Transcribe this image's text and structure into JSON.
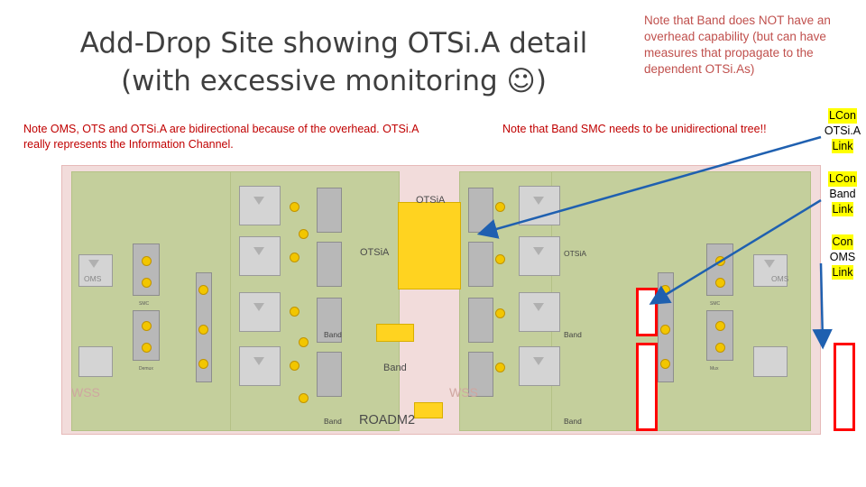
{
  "title": {
    "line1": "Add-Drop Site showing OTSi.A detail",
    "line2": "(with excessive monitoring ☺)",
    "text": "Add-Drop Site showing OTSi.A detail\n(with excessive monitoring ☺)"
  },
  "notes": {
    "orange_top_right": "Note that Band does NOT have an overhead capability (but can have measures that propagate to the dependent OTSi.As)",
    "red_left": "Note OMS, OTS and OTSi.A are bidirectional because of the overhead. OTSi.A really represents the Information Channel.",
    "red_middle": "Note that Band SMC needs to be unidirectional tree!!"
  },
  "legend": {
    "items": [
      {
        "name": "legend-otsia",
        "line1": "LCon",
        "line2": "OTSi.A",
        "line3": "Link"
      },
      {
        "name": "legend-band",
        "line1": "LCon",
        "line2": "Band",
        "line3": "Link"
      },
      {
        "name": "legend-oms",
        "line1": "Con",
        "line2": "OMS",
        "line3": "Link"
      }
    ]
  },
  "diagram": {
    "labels": {
      "otsia_big": "OTSiA",
      "otsia_small": "OTSiA",
      "band_right": "Band",
      "band_center": "Band",
      "band_bottom": "Band",
      "band_left": "Band",
      "oms_left": "OMS",
      "oms_right": "OMS",
      "wss_left": "WSS",
      "wss_right": "WSS",
      "roadm": "ROADM2"
    },
    "colors": {
      "frame_fill": "#f2dcdb",
      "node_fill": "#c4cf9c",
      "highlight": "#ffd320",
      "arrow": "#1f60b0",
      "red_outline": "#ff0000",
      "note_red": "#c00000",
      "note_orange": "#c0504d",
      "title_text": "#3f3f3f"
    }
  }
}
